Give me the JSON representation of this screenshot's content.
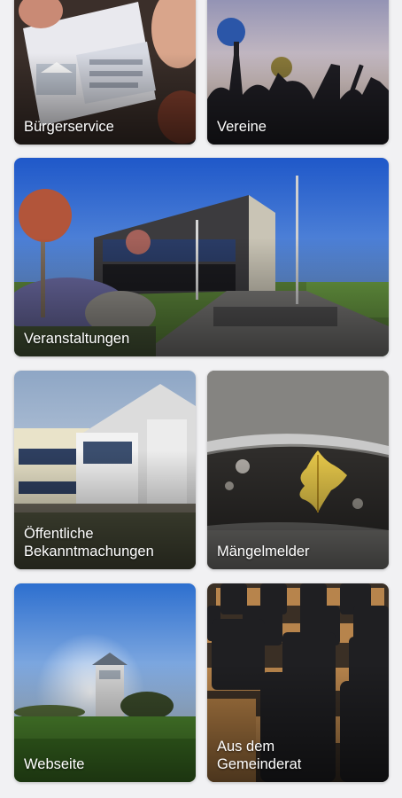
{
  "tiles": {
    "buergerservice": {
      "label": "Bürgerservice"
    },
    "vereine": {
      "label": "Vereine"
    },
    "veranstaltungen": {
      "label": "Veranstaltungen"
    },
    "bekanntmachungen": {
      "label": "Öffentliche\nBekanntmachungen"
    },
    "maengelmelder": {
      "label": "Mängelmelder"
    },
    "webseite": {
      "label": "Webseite"
    },
    "gemeinderat": {
      "label": "Aus dem\nGemeinderat"
    }
  },
  "colors": {
    "page_background": "#f1f1f3",
    "label_text": "#ffffff"
  }
}
